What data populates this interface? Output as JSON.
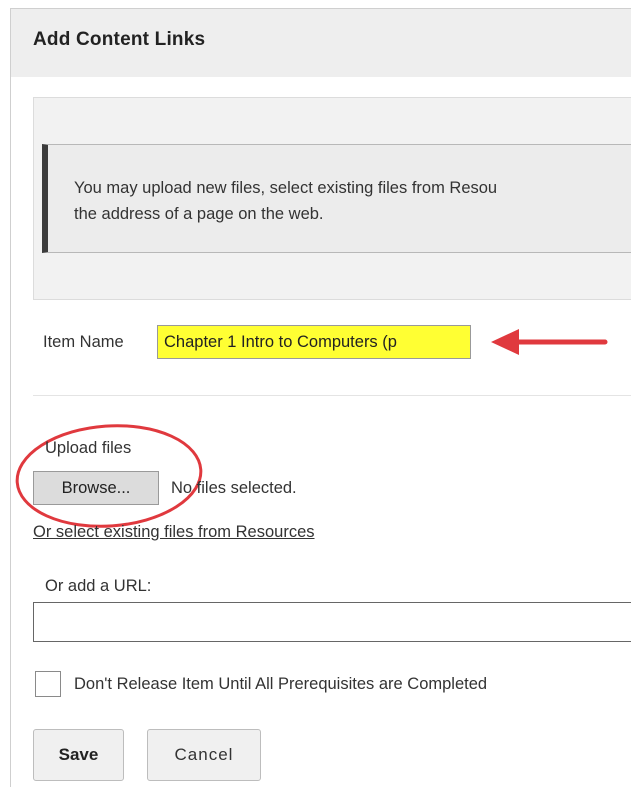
{
  "header": {
    "title": "Add Content Links"
  },
  "info": {
    "line1": "You may upload new files, select existing files from Resou",
    "line2": "the address of a page on the web."
  },
  "item_name": {
    "label": "Item Name",
    "value": "Chapter 1 Intro to Computers (p",
    "highlight_color": "#ffff33"
  },
  "upload": {
    "label": "Upload files",
    "browse_label": "Browse...",
    "status": "No files selected."
  },
  "resources_link": "Or select existing files from Resources",
  "url": {
    "label": "Or add a URL:",
    "value": ""
  },
  "prerequisite": {
    "label": "Don't Release Item Until All Prerequisites are Completed",
    "checked": false
  },
  "buttons": {
    "save_label": "Save",
    "cancel_label": "Cancel"
  },
  "annotations": {
    "arrow_color": "#e0393e",
    "circle_color": "#e0393e",
    "arrow_icon": "left-arrow-icon",
    "circle_icon": "highlight-circle-icon"
  }
}
